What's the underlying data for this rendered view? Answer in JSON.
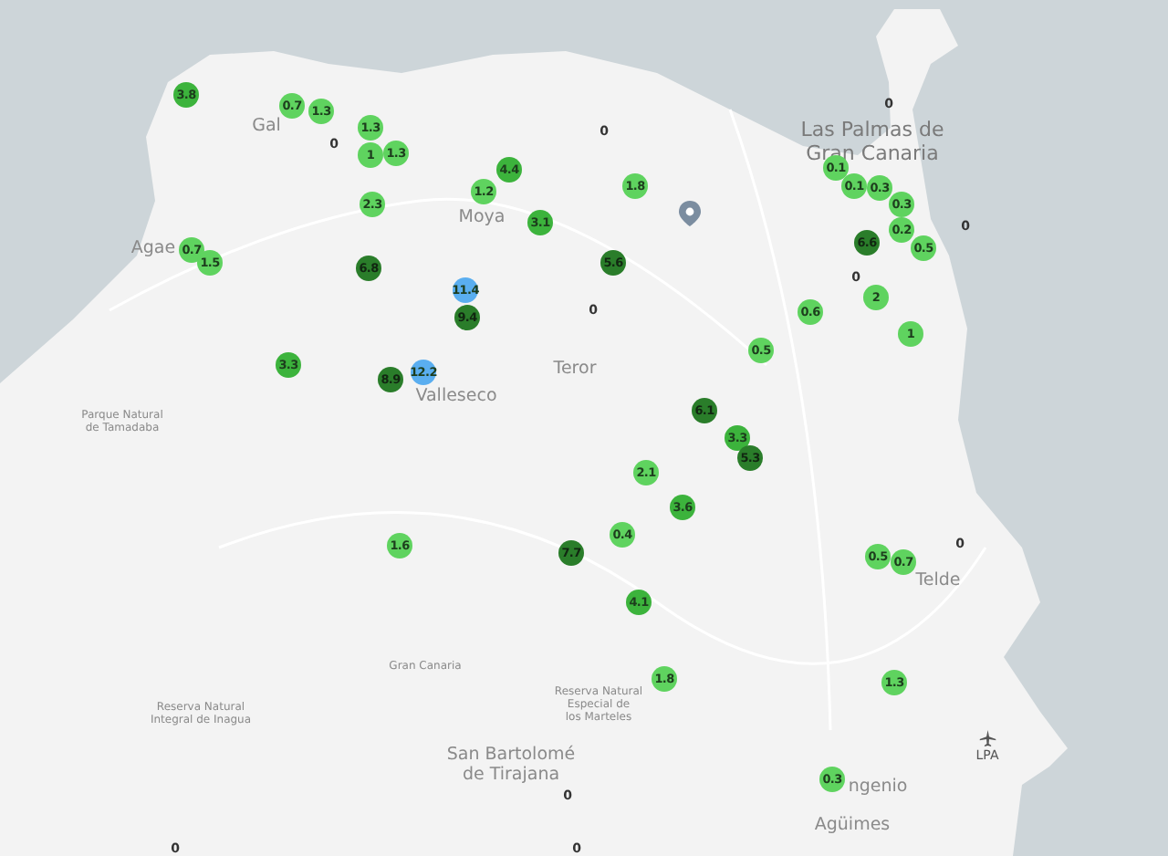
{
  "map": {
    "markers": [
      {
        "kind": "reading",
        "value": "3.8",
        "color": "#3cb33c"
      },
      {
        "kind": "reading",
        "value": "0.7",
        "color": "#5fd35f"
      },
      {
        "kind": "reading",
        "value": "1.3",
        "color": "#5fd35f"
      },
      {
        "kind": "zero",
        "value": "0"
      },
      {
        "kind": "reading",
        "value": "1.3",
        "color": "#5fd35f"
      },
      {
        "kind": "reading",
        "value": "1",
        "color": "#5fd35f"
      },
      {
        "kind": "reading",
        "value": "1.3",
        "color": "#5fd35f"
      },
      {
        "kind": "reading",
        "value": "4.4",
        "color": "#3cb33c"
      },
      {
        "kind": "reading",
        "value": "1.2",
        "color": "#5fd35f"
      },
      {
        "kind": "reading",
        "value": "2.3",
        "color": "#5fd35f"
      },
      {
        "kind": "zero",
        "value": "0"
      },
      {
        "kind": "reading",
        "value": "1.8",
        "color": "#5fd35f"
      },
      {
        "kind": "reading",
        "value": "3.1",
        "color": "#3cb33c"
      },
      {
        "kind": "reading",
        "value": "0.7",
        "color": "#5fd35f"
      },
      {
        "kind": "reading",
        "value": "1.5",
        "color": "#5fd35f"
      },
      {
        "kind": "reading",
        "value": "6.8",
        "color": "#2a7d2a"
      },
      {
        "kind": "reading",
        "value": "5.6",
        "color": "#2a7d2a"
      },
      {
        "kind": "reading",
        "value": "11.4",
        "color": "#5aaef0"
      },
      {
        "kind": "reading",
        "value": "9.4",
        "color": "#2a7d2a"
      },
      {
        "kind": "zero",
        "value": "0"
      },
      {
        "kind": "zero",
        "value": "0"
      },
      {
        "kind": "reading",
        "value": "0.1",
        "color": "#5fd35f"
      },
      {
        "kind": "reading",
        "value": "0.1",
        "color": "#5fd35f"
      },
      {
        "kind": "reading",
        "value": "0.3",
        "color": "#5fd35f"
      },
      {
        "kind": "reading",
        "value": "0.3",
        "color": "#5fd35f"
      },
      {
        "kind": "reading",
        "value": "0.2",
        "color": "#5fd35f"
      },
      {
        "kind": "reading",
        "value": "6.6",
        "color": "#2a7d2a"
      },
      {
        "kind": "reading",
        "value": "0.5",
        "color": "#5fd35f"
      },
      {
        "kind": "zero",
        "value": "0"
      },
      {
        "kind": "zero",
        "value": "0"
      },
      {
        "kind": "reading",
        "value": "2",
        "color": "#5fd35f"
      },
      {
        "kind": "reading",
        "value": "0.6",
        "color": "#5fd35f"
      },
      {
        "kind": "reading",
        "value": "1",
        "color": "#5fd35f"
      },
      {
        "kind": "reading",
        "value": "0.5",
        "color": "#5fd35f"
      },
      {
        "kind": "reading",
        "value": "3.3",
        "color": "#3cb33c"
      },
      {
        "kind": "reading",
        "value": "8.9",
        "color": "#2a7d2a"
      },
      {
        "kind": "reading",
        "value": "12.2",
        "color": "#5aaef0"
      },
      {
        "kind": "reading",
        "value": "6.1",
        "color": "#2a7d2a"
      },
      {
        "kind": "reading",
        "value": "3.3",
        "color": "#3cb33c"
      },
      {
        "kind": "reading",
        "value": "5.3",
        "color": "#2a7d2a"
      },
      {
        "kind": "reading",
        "value": "2.1",
        "color": "#5fd35f"
      },
      {
        "kind": "reading",
        "value": "3.6",
        "color": "#3cb33c"
      },
      {
        "kind": "reading",
        "value": "0.4",
        "color": "#5fd35f"
      },
      {
        "kind": "reading",
        "value": "7.7",
        "color": "#2a7d2a"
      },
      {
        "kind": "reading",
        "value": "1.6",
        "color": "#5fd35f"
      },
      {
        "kind": "reading",
        "value": "0.5",
        "color": "#5fd35f"
      },
      {
        "kind": "reading",
        "value": "0.7",
        "color": "#5fd35f"
      },
      {
        "kind": "zero",
        "value": "0"
      },
      {
        "kind": "reading",
        "value": "4.1",
        "color": "#3cb33c"
      },
      {
        "kind": "reading",
        "value": "1.8",
        "color": "#5fd35f"
      },
      {
        "kind": "reading",
        "value": "1.3",
        "color": "#5fd35f"
      },
      {
        "kind": "reading",
        "value": "0.3",
        "color": "#5fd35f"
      },
      {
        "kind": "zero",
        "value": "0"
      },
      {
        "kind": "zero",
        "value": "0"
      },
      {
        "kind": "zero",
        "value": "0"
      }
    ],
    "place_labels": [
      {
        "kind": "town",
        "lines": [
          "Gal"
        ]
      },
      {
        "kind": "city",
        "lines": [
          "Las Palmas de",
          "Gran Canaria"
        ]
      },
      {
        "kind": "town",
        "lines": [
          "Moya"
        ]
      },
      {
        "kind": "town",
        "lines": [
          "Agae"
        ]
      },
      {
        "kind": "town",
        "lines": [
          "Teror"
        ]
      },
      {
        "kind": "town",
        "lines": [
          "Valleseco"
        ]
      },
      {
        "kind": "park",
        "lines": [
          "Parque Natural",
          "de Tamadaba"
        ]
      },
      {
        "kind": "town",
        "lines": [
          "Telde"
        ]
      },
      {
        "kind": "park",
        "lines": [
          "Gran Canaria"
        ]
      },
      {
        "kind": "park",
        "lines": [
          "Reserva Natural",
          "Integral de Inagua"
        ]
      },
      {
        "kind": "park",
        "lines": [
          "Reserva Natural",
          "Especial de",
          "los Marteles"
        ]
      },
      {
        "kind": "town",
        "lines": [
          "San Bartolomé",
          "de Tirajana"
        ]
      },
      {
        "kind": "town",
        "lines": [
          "ngenio"
        ]
      },
      {
        "kind": "town",
        "lines": [
          "Agüimes"
        ]
      }
    ],
    "airport": {
      "code": "LPA"
    }
  }
}
